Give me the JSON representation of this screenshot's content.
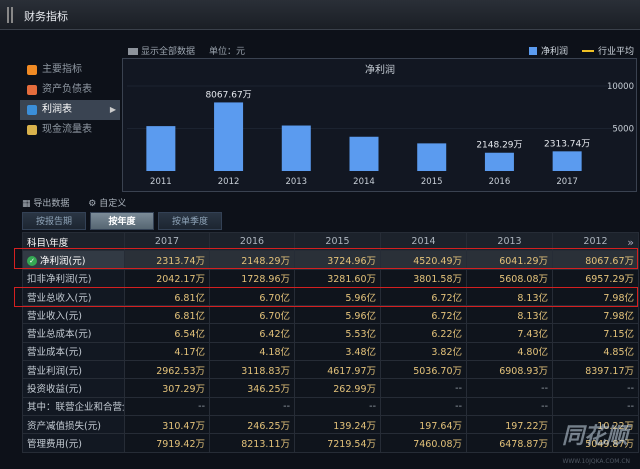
{
  "window": {
    "title": "财务指标"
  },
  "options": {
    "show_all": "显示全部数据",
    "unit": "单位：元"
  },
  "legend": {
    "series": "净利润",
    "avg": "行业平均"
  },
  "sidebar": {
    "items": [
      {
        "label": "主要指标",
        "color": "#f08a24"
      },
      {
        "label": "资产负债表",
        "color": "#e46c3c"
      },
      {
        "label": "利润表",
        "color": "#3b8ed8"
      },
      {
        "label": "现金流量表",
        "color": "#d9b24c"
      }
    ],
    "active": 2
  },
  "chart_data": {
    "type": "bar",
    "title": "净利润",
    "categories": [
      "2011",
      "2012",
      "2013",
      "2014",
      "2015",
      "2016",
      "2017"
    ],
    "values": [
      5280,
      8067.67,
      5350,
      4030,
      3250,
      2148.29,
      2313.74
    ],
    "data_labels": {
      "2012": "8067.67万",
      "2016": "2148.29万",
      "2017": "2313.74万"
    },
    "yticks": [
      5000,
      10000
    ],
    "ylim": [
      0,
      12000
    ],
    "color": "#5b9bef"
  },
  "toolbar": {
    "export": "导出数据",
    "custom": "自定义"
  },
  "tabs": [
    "按报告期",
    "按年度",
    "按单季度"
  ],
  "active_tab": 1,
  "table": {
    "header": [
      "科目\\年度",
      "2017",
      "2016",
      "2015",
      "2014",
      "2013",
      "2012"
    ],
    "rows": [
      [
        "净利润(元)",
        "2313.74万",
        "2148.29万",
        "3724.96万",
        "4520.49万",
        "6041.29万",
        "8067.67万"
      ],
      [
        "扣非净利润(元)",
        "2042.17万",
        "1728.96万",
        "3281.60万",
        "3801.58万",
        "5608.08万",
        "6957.29万"
      ],
      [
        "营业总收入(元)",
        "6.81亿",
        "6.70亿",
        "5.96亿",
        "6.72亿",
        "8.13亿",
        "7.98亿"
      ],
      [
        "营业收入(元)",
        "6.81亿",
        "6.70亿",
        "5.96亿",
        "6.72亿",
        "8.13亿",
        "7.98亿"
      ],
      [
        "营业总成本(元)",
        "6.54亿",
        "6.42亿",
        "5.53亿",
        "6.22亿",
        "7.43亿",
        "7.15亿"
      ],
      [
        "营业成本(元)",
        "4.17亿",
        "4.18亿",
        "3.48亿",
        "3.82亿",
        "4.80亿",
        "4.85亿"
      ],
      [
        "营业利润(元)",
        "2962.53万",
        "3118.83万",
        "4617.97万",
        "5036.70万",
        "6908.93万",
        "8397.17万"
      ],
      [
        "投资收益(元)",
        "307.29万",
        "346.25万",
        "262.99万",
        "--",
        "--",
        "--"
      ],
      [
        "其中：联营企业和合营企业的投资收益(元)",
        "--",
        "--",
        "--",
        "--",
        "--",
        "--"
      ],
      [
        "资产减值损失(元)",
        "310.47万",
        "246.25万",
        "139.24万",
        "197.64万",
        "197.22万",
        "10.22万"
      ],
      [
        "管理费用(元)",
        "7919.42万",
        "8213.11万",
        "7219.54万",
        "7460.08万",
        "6478.87万",
        "5049.87万"
      ]
    ]
  },
  "watermark": {
    "brand": "同花顺",
    "site": "WWW.10JQKA.COM.CN"
  }
}
